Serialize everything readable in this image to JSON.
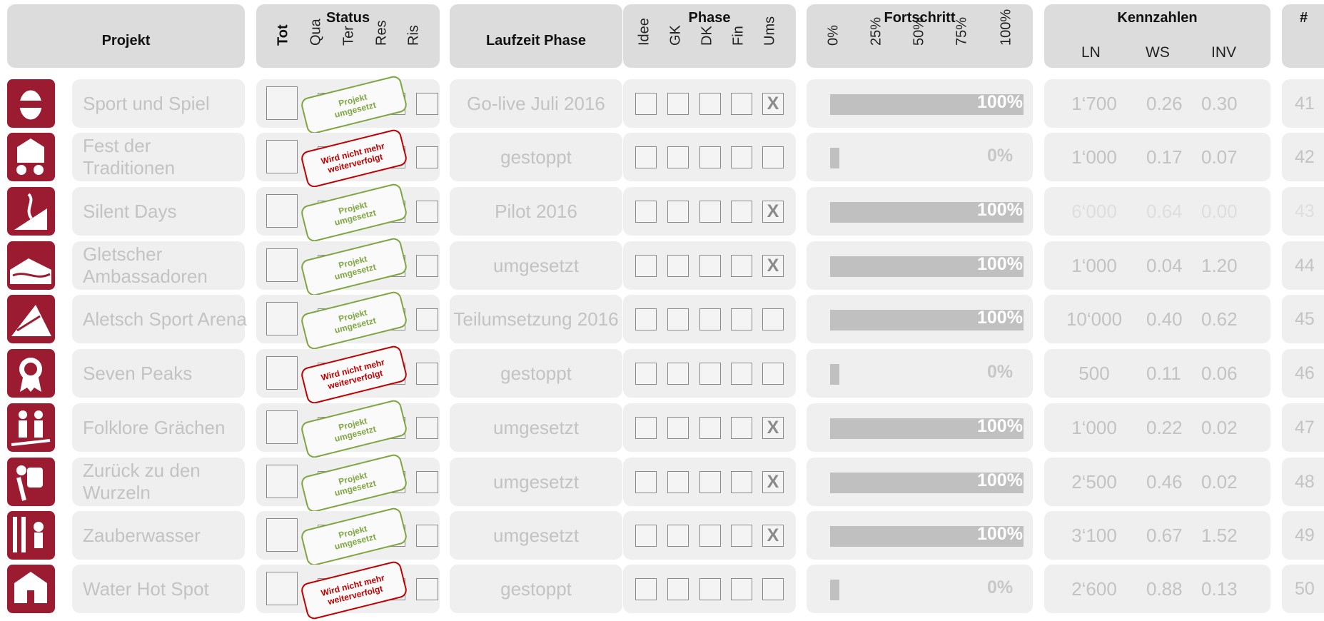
{
  "header": {
    "projekt": "Projekt",
    "status": {
      "title": "Status",
      "cols": [
        "Tot",
        "Qua",
        "Ter",
        "Res",
        "Ris"
      ]
    },
    "laufzeit": "Laufzeit Phase",
    "phase": {
      "title": "Phase",
      "cols": [
        "Idee",
        "GK",
        "DK",
        "Fin",
        "Ums"
      ]
    },
    "fortschritt": {
      "title": "Fortschritt",
      "cols": [
        "0%",
        "25%",
        "50%",
        "75%",
        "100%"
      ]
    },
    "kennzahlen": {
      "title": "Kennzahlen",
      "cols": [
        "LN",
        "WS",
        "INV"
      ]
    },
    "nr": "#"
  },
  "stamps": {
    "green": [
      "Projekt",
      "umgesetzt"
    ],
    "red": [
      "Wird nicht mehr",
      "weiterverfolgt"
    ]
  },
  "colors": {
    "brand": "#9b1b30",
    "green_stamp": "#7ea640",
    "red_stamp": "#c00000",
    "bar": "#c0c0c0"
  },
  "rows": [
    {
      "name": "Sport und Spiel",
      "icon": "kinder-egg-icon",
      "stamp": "green",
      "laufzeit": "Go-live Juli 2016",
      "ums": "X",
      "progress": 100,
      "progress_label": "100%",
      "ln": "1‘700",
      "ws": "0.26",
      "inv": "0.30",
      "nr": "41",
      "faint": false
    },
    {
      "name": "Fest der Traditionen",
      "icon": "festival-icon",
      "stamp": "red",
      "laufzeit": "gestoppt",
      "ums": "",
      "progress": 0,
      "progress_label": "0%",
      "ln": "1‘000",
      "ws": "0.17",
      "inv": "0.07",
      "nr": "42",
      "faint": false
    },
    {
      "name": "Silent Days",
      "icon": "meditation-icon",
      "stamp": "green",
      "laufzeit": "Pilot 2016",
      "ums": "X",
      "progress": 100,
      "progress_label": "100%",
      "ln": "6‘000",
      "ws": "0.64",
      "inv": "0.00",
      "nr": "43",
      "faint": true
    },
    {
      "name": "Gletscher Ambassadoren",
      "icon": "glacier-icon",
      "stamp": "green",
      "laufzeit": "umgesetzt",
      "ums": "X",
      "progress": 100,
      "progress_label": "100%",
      "ln": "1‘000",
      "ws": "0.04",
      "inv": "1.20",
      "nr": "44",
      "faint": false
    },
    {
      "name": "Aletsch Sport Arena",
      "icon": "mountain-sport-icon",
      "stamp": "green",
      "laufzeit": "Teilumsetzung 2016",
      "ums": "",
      "progress": 100,
      "progress_label": "100%",
      "ln": "10‘000",
      "ws": "0.40",
      "inv": "0.62",
      "nr": "45",
      "faint": false
    },
    {
      "name": "Seven Peaks",
      "icon": "medal-icon",
      "stamp": "red",
      "laufzeit": "gestoppt",
      "ums": "",
      "progress": 0,
      "progress_label": "0%",
      "ln": "500",
      "ws": "0.11",
      "inv": "0.06",
      "nr": "46",
      "faint": false
    },
    {
      "name": "Folklore Grächen",
      "icon": "alphorn-icon",
      "stamp": "green",
      "laufzeit": "umgesetzt",
      "ums": "X",
      "progress": 100,
      "progress_label": "100%",
      "ln": "1‘000",
      "ws": "0.22",
      "inv": "0.02",
      "nr": "47",
      "faint": false
    },
    {
      "name": "Zurück zu den Wurzeln",
      "icon": "basket-carrier-icon",
      "stamp": "green",
      "laufzeit": "umgesetzt",
      "ums": "X",
      "progress": 100,
      "progress_label": "100%",
      "ln": "2‘500",
      "ws": "0.46",
      "inv": "0.02",
      "nr": "48",
      "faint": false
    },
    {
      "name": "Zauberwasser",
      "icon": "water-trail-icon",
      "stamp": "green",
      "laufzeit": "umgesetzt",
      "ums": "X",
      "progress": 100,
      "progress_label": "100%",
      "ln": "3‘100",
      "ws": "0.67",
      "inv": "1.52",
      "nr": "49",
      "faint": false
    },
    {
      "name": "Water Hot Spot",
      "icon": "hot-spot-icon",
      "stamp": "red",
      "laufzeit": "gestoppt",
      "ums": "",
      "progress": 0,
      "progress_label": "0%",
      "ln": "2‘600",
      "ws": "0.88",
      "inv": "0.13",
      "nr": "50",
      "faint": false
    }
  ]
}
